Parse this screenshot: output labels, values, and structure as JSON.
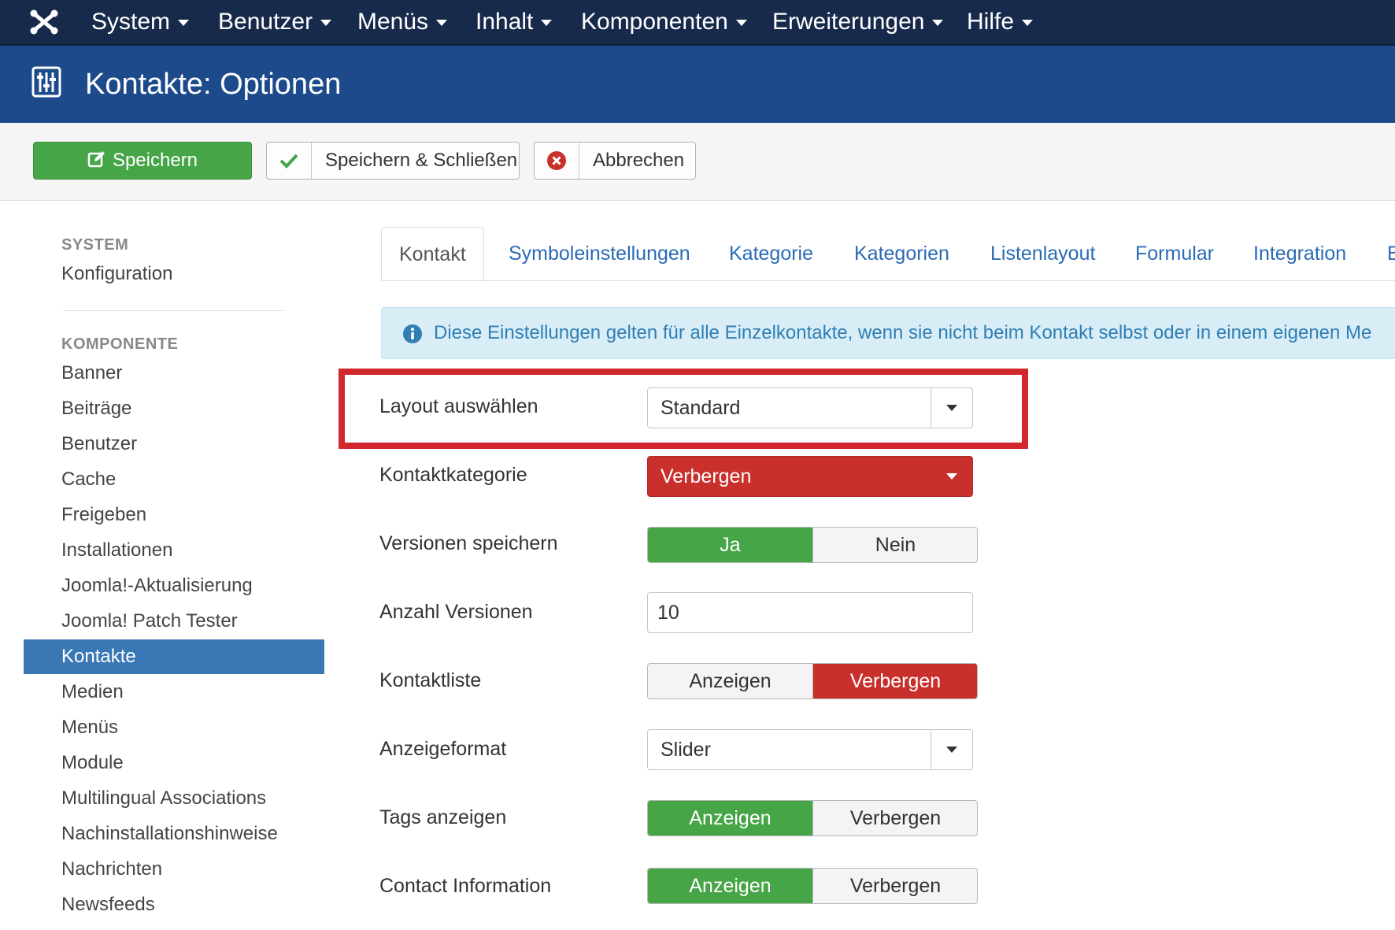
{
  "topnav": {
    "logo": "joomla-logo",
    "items": [
      {
        "label": "System"
      },
      {
        "label": "Benutzer"
      },
      {
        "label": "Menüs"
      },
      {
        "label": "Inhalt"
      },
      {
        "label": "Komponenten"
      },
      {
        "label": "Erweiterungen"
      },
      {
        "label": "Hilfe"
      }
    ]
  },
  "header": {
    "icon": "options-sliders-icon",
    "title": "Kontakte: Optionen"
  },
  "toolbar": {
    "save_label": "Speichern",
    "save_close_label": "Speichern & Schließen",
    "cancel_label": "Abbrechen"
  },
  "sidebar": {
    "system_heading": "SYSTEM",
    "system_items": [
      {
        "label": "Konfiguration"
      }
    ],
    "component_heading": "KOMPONENTE",
    "component_items": [
      {
        "label": "Banner"
      },
      {
        "label": "Beiträge"
      },
      {
        "label": "Benutzer"
      },
      {
        "label": "Cache"
      },
      {
        "label": "Freigeben"
      },
      {
        "label": "Installationen"
      },
      {
        "label": "Joomla!-Aktualisierung"
      },
      {
        "label": "Joomla! Patch Tester"
      },
      {
        "label": "Kontakte",
        "active": true
      },
      {
        "label": "Medien"
      },
      {
        "label": "Menüs"
      },
      {
        "label": "Module"
      },
      {
        "label": "Multilingual Associations"
      },
      {
        "label": "Nachinstallationshinweise"
      },
      {
        "label": "Nachrichten"
      },
      {
        "label": "Newsfeeds"
      }
    ]
  },
  "tabs": [
    {
      "label": "Kontakt",
      "active": true
    },
    {
      "label": "Symboleinstellungen"
    },
    {
      "label": "Kategorie"
    },
    {
      "label": "Kategorien"
    },
    {
      "label": "Listenlayout"
    },
    {
      "label": "Formular"
    },
    {
      "label": "Integration"
    },
    {
      "label": "B"
    }
  ],
  "alert": {
    "text": "Diese Einstellungen gelten für alle Einzelkontakte, wenn sie nicht beim Kontakt selbst oder in einem eigenen Me"
  },
  "form": {
    "layout": {
      "label": "Layout auswählen",
      "value": "Standard"
    },
    "contact_category": {
      "label": "Kontaktkategorie",
      "value": "Verbergen"
    },
    "save_versions": {
      "label": "Versionen speichern",
      "options": [
        "Ja",
        "Nein"
      ],
      "selected": "Ja"
    },
    "num_versions": {
      "label": "Anzahl Versionen",
      "value": "10"
    },
    "contact_list": {
      "label": "Kontaktliste",
      "options": [
        "Anzeigen",
        "Verbergen"
      ],
      "selected": "Verbergen"
    },
    "display_format": {
      "label": "Anzeigeformat",
      "value": "Slider"
    },
    "show_tags": {
      "label": "Tags anzeigen",
      "options": [
        "Anzeigen",
        "Verbergen"
      ],
      "selected": "Anzeigen"
    },
    "contact_info": {
      "label": "Contact Information",
      "options": [
        "Anzeigen",
        "Verbergen"
      ],
      "selected": "Anzeigen"
    }
  },
  "colors": {
    "topnav": "#182a4b",
    "header": "#1c4a8b",
    "success": "#46a546",
    "danger": "#c9302c",
    "link": "#2a6ab5",
    "highlight": "#d0282d"
  }
}
